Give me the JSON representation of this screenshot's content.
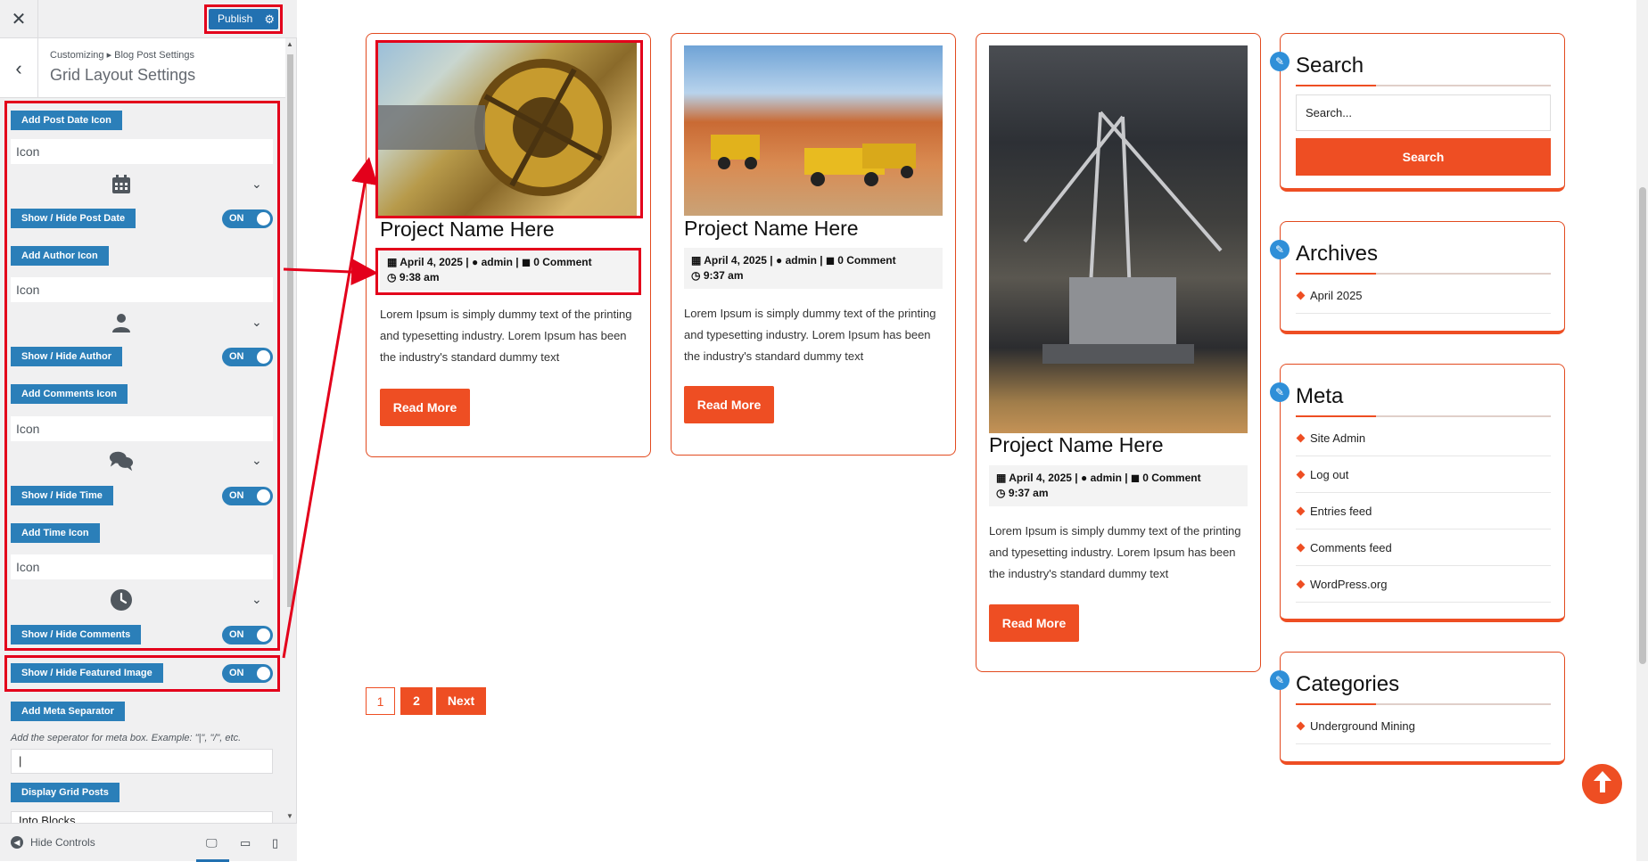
{
  "customizer": {
    "publish_label": "Publish",
    "breadcrumb": "Customizing ▸ Blog Post Settings",
    "section_title": "Grid Layout Settings",
    "icon_placeholder": "Icon",
    "controls": {
      "post_date_icon": "Add Post Date Icon",
      "show_post_date": "Show / Hide Post Date",
      "author_icon": "Add Author Icon",
      "show_author": "Show / Hide Author",
      "comments_icon": "Add Comments Icon",
      "show_time": "Show / Hide Time",
      "time_icon": "Add Time Icon",
      "show_comments": "Show / Hide Comments",
      "show_featured_image": "Show / Hide Featured Image",
      "meta_separator": "Add Meta Separator",
      "display_grid_posts": "Display Grid Posts"
    },
    "toggle_label": "ON",
    "separator_help": "Add the seperator for meta box. Example: \"|\", \"/\", etc.",
    "separator_value": "|",
    "grid_posts_value": "Into Blocks",
    "hide_controls": "Hide Controls"
  },
  "posts": [
    {
      "title": "Project Name Here",
      "date": "April 4, 2025",
      "author": "admin",
      "comments": "0 Comment",
      "time": "9:38 am",
      "excerpt": "Lorem Ipsum is simply dummy text of the printing and typesetting industry. Lorem Ipsum has been the industry's standard dummy text",
      "read_more": "Read More"
    },
    {
      "title": "Project Name Here",
      "date": "April 4, 2025",
      "author": "admin",
      "comments": "0 Comment",
      "time": "9:37 am",
      "excerpt": "Lorem Ipsum is simply dummy text of the printing and typesetting industry. Lorem Ipsum has been the industry's standard dummy text",
      "read_more": "Read More"
    },
    {
      "title": "Project Name Here",
      "date": "April 4, 2025",
      "author": "admin",
      "comments": "0 Comment",
      "time": "9:37 am",
      "excerpt": "Lorem Ipsum is simply dummy text of the printing and typesetting industry. Lorem Ipsum has been the industry's standard dummy text",
      "read_more": "Read More"
    }
  ],
  "pagination": {
    "page1": "1",
    "page2": "2",
    "next": "Next"
  },
  "sidebar": {
    "search": {
      "title": "Search",
      "placeholder": "Search...",
      "button": "Search"
    },
    "archives": {
      "title": "Archives",
      "items": [
        "April 2025"
      ]
    },
    "meta": {
      "title": "Meta",
      "items": [
        "Site Admin",
        "Log out",
        "Entries feed",
        "Comments feed",
        "WordPress.org"
      ]
    },
    "categories": {
      "title": "Categories",
      "items": [
        "Underground Mining"
      ]
    }
  },
  "colors": {
    "accent": "#ee4e23",
    "customizer_blue": "#2b7fb9",
    "highlight": "#e3001b"
  }
}
